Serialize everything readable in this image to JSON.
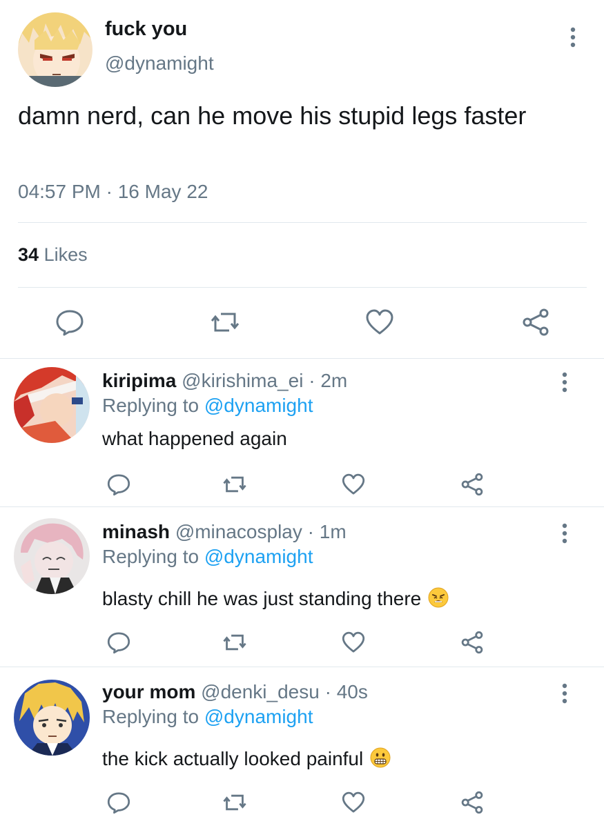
{
  "main": {
    "name": "fuck you",
    "handle": "@dynamight",
    "text": "damn nerd, can he move his stupid legs faster",
    "time": "04:57 PM · 16 May 22",
    "likes_count": "34",
    "likes_label": "Likes"
  },
  "replies": [
    {
      "name": "kiripima",
      "handle": "@kirishima_ei",
      "sep": "·",
      "time": "2m",
      "replying_label": "Replying to",
      "replying_handle": "@dynamight",
      "text": "what happened again",
      "emoji": ""
    },
    {
      "name": "minash",
      "handle": "@minacosplay",
      "sep": "·",
      "time": "1m",
      "replying_label": "Replying to",
      "replying_handle": "@dynamight",
      "text": "blasty chill he was just standing there",
      "emoji": "weary-face"
    },
    {
      "name": "your mom",
      "handle": "@denki_desu",
      "sep": "·",
      "time": "40s",
      "replying_label": "Replying to",
      "replying_handle": "@dynamight",
      "text": "the kick actually looked painful",
      "emoji": "grimacing-face"
    }
  ],
  "icons": {
    "reply": "speech-bubble-icon",
    "retweet": "retweet-icon",
    "like": "heart-icon",
    "share": "share-icon",
    "more": "vertical-ellipsis-icon"
  },
  "colors": {
    "text": "#14171a",
    "muted": "#657786",
    "link": "#1da1f2",
    "divider": "#e1e8ed"
  }
}
